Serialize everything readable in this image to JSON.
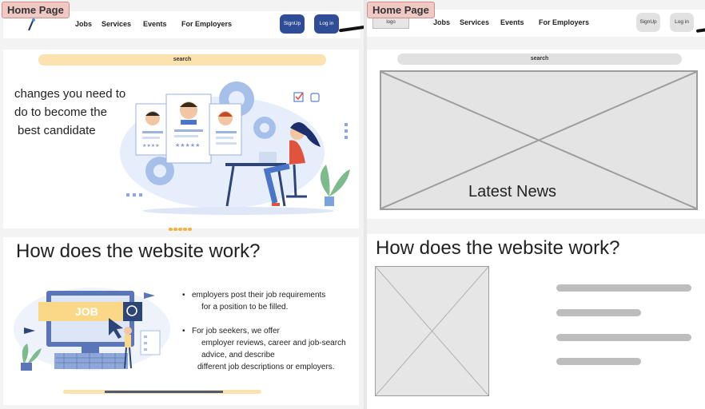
{
  "left": {
    "tag": "Home Page",
    "nav": {
      "jobs": "Jobs",
      "services": "Services",
      "events": "Events",
      "employers": "For Employers",
      "signup": "SignUp",
      "login": "Log in"
    },
    "search": "search",
    "hero": [
      "changes you need to",
      "do to become the",
      "best candidate"
    ],
    "illustration_1": {
      "button": "search"
    },
    "how_title": "How does the website work?",
    "job_badge": "JOB",
    "bullets": [
      {
        "line": "employers post their job requirements",
        "cont": [
          "for a position to be filled."
        ]
      },
      {
        "line": "For job seekers, we offer",
        "cont": [
          "employer reviews, career and job-search",
          "advice, and describe",
          "different job descriptions or employers."
        ]
      }
    ]
  },
  "right": {
    "tag": "Home Page",
    "logo": "logo",
    "nav": {
      "jobs": "Jobs",
      "services": "Services",
      "events": "Events",
      "employers": "For Employers",
      "signup": "SignUp",
      "login": "Log in"
    },
    "search": "search",
    "banner": "Latest News",
    "how_title": "How does the website work?"
  },
  "colors": {
    "accent_dark": "#2f4d97",
    "search_yellow": "#fbe2ae",
    "placeholder_gray": "#e4e4e4",
    "bar_gray": "#bdbdbd"
  }
}
